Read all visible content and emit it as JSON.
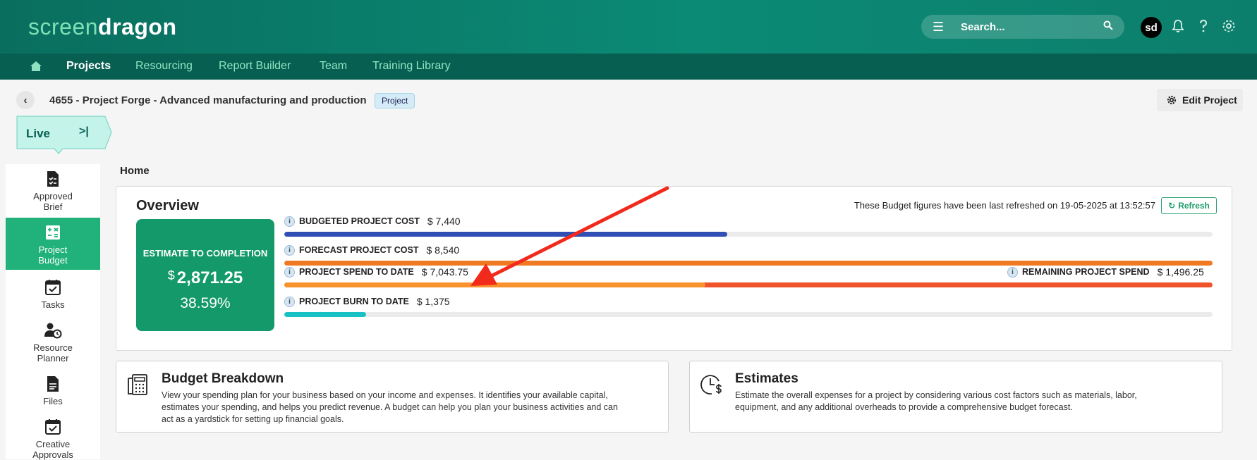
{
  "app": {
    "logo_part1": "screen",
    "logo_part2": "dragon",
    "search_placeholder": "Search...",
    "avatar_initials": "sd",
    "nav": [
      "Projects",
      "Resourcing",
      "Report Builder",
      "Team",
      "Training Library"
    ],
    "active_nav": "Projects"
  },
  "project": {
    "title": "4655 - Project Forge - Advanced manufacturing and production",
    "tag": "Project",
    "edit_label": "Edit Project",
    "status": "Live",
    "status_chevron": ">|"
  },
  "sidebar": {
    "items": [
      {
        "label1": "Approved",
        "label2": "Brief",
        "icon": "approved-brief-icon"
      },
      {
        "label1": "Project",
        "label2": "Budget",
        "icon": "calculator-icon",
        "active": true
      },
      {
        "label1": "Tasks",
        "label2": "",
        "icon": "calendar-check-icon"
      },
      {
        "label1": "Resource",
        "label2": "Planner",
        "icon": "resource-planner-icon"
      },
      {
        "label1": "Files",
        "label2": "",
        "icon": "file-icon"
      },
      {
        "label1": "Creative",
        "label2": "Approvals",
        "icon": "calendar-check-icon"
      }
    ]
  },
  "breadcrumb": "Home",
  "overview": {
    "title": "Overview",
    "refresh_note": "These Budget figures have been last refreshed on 19-05-2025 at 13:52:57",
    "refresh_label": "Refresh",
    "etc_label": "ESTIMATE TO COMPLETION",
    "etc_currency": "$",
    "etc_value": "2,871.25",
    "etc_percent": "38.59%",
    "info_glyph": "i",
    "metrics": {
      "budgeted": {
        "label": "BUDGETED PROJECT COST",
        "value": "$ 7,440",
        "fill": 0.477,
        "color": "#2f4fb5"
      },
      "forecast": {
        "label": "FORECAST PROJECT COST",
        "value": "$ 8,540",
        "fill": 1.0,
        "color": "#f07a24"
      },
      "spend": {
        "label": "PROJECT SPEND TO DATE",
        "value": "$ 7,043.75",
        "fill": 0.454,
        "color": "#f9922d"
      },
      "remaining": {
        "label": "REMAINING PROJECT SPEND",
        "value": "$ 1,496.25",
        "color": "#f0522a"
      },
      "burn": {
        "label": "PROJECT BURN TO DATE",
        "value": "$ 1,375",
        "fill": 0.088,
        "color": "#18c2c4"
      }
    }
  },
  "cards": {
    "budget": {
      "title": "Budget Breakdown",
      "line1": "View your spending plan for your business based on your income and expenses. It identifies your available capital,",
      "line2": "estimates your spending, and helps you predict revenue. A budget can help you plan your business activities and can",
      "line3": "act as a yardstick for setting up financial goals."
    },
    "estimates": {
      "title": "Estimates",
      "line1": "Estimate the overall expenses for a project by considering various cost factors such as materials, labor,",
      "line2": "equipment, and any additional overheads to provide a comprehensive budget forecast."
    }
  }
}
